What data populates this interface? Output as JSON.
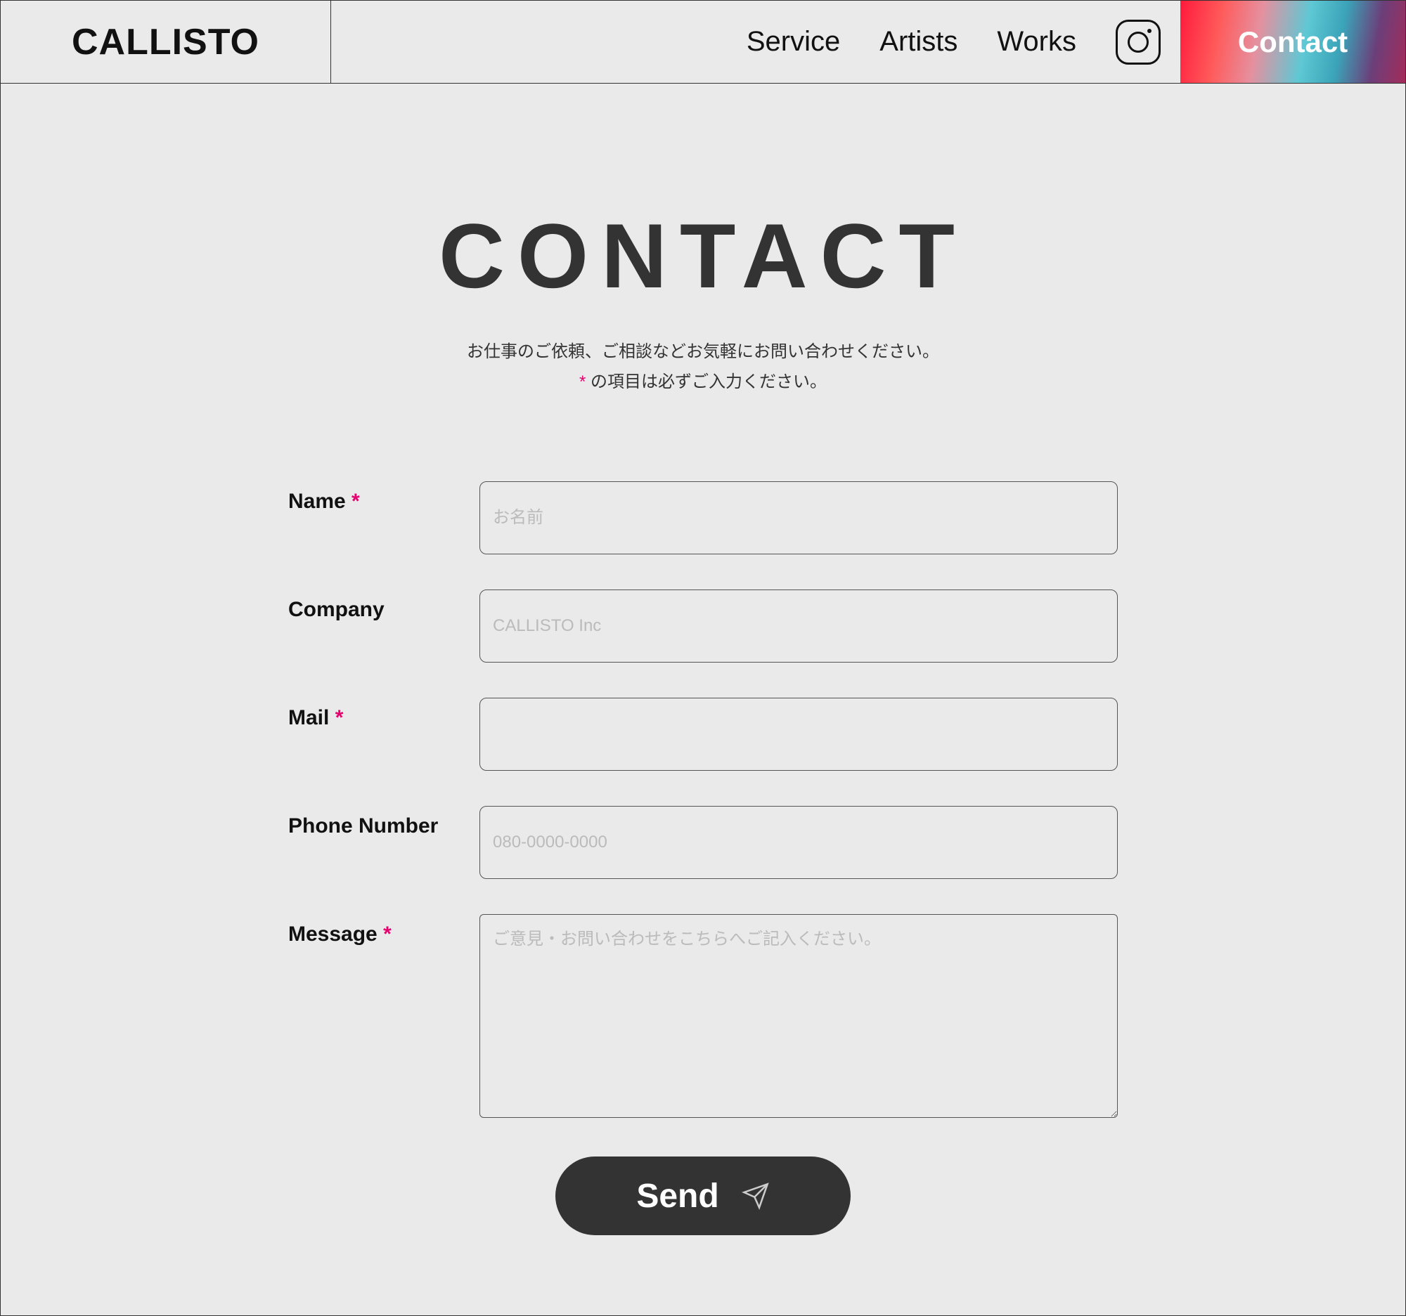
{
  "header": {
    "logo": "CALLISTO",
    "nav": {
      "service": "Service",
      "artists": "Artists",
      "works": "Works",
      "contact": "Contact"
    }
  },
  "main": {
    "title": "CONTACT",
    "subtitle_line1": "お仕事のご依頼、ご相談などお気軽にお問い合わせください。",
    "subtitle_asterisk": "*",
    "subtitle_line2_after": " の項目は必ずご入力ください。"
  },
  "form": {
    "name": {
      "label": "Name ",
      "required": "*",
      "placeholder": "お名前"
    },
    "company": {
      "label": "Company",
      "placeholder": "CALLISTO Inc"
    },
    "mail": {
      "label": "Mail ",
      "required": "*",
      "placeholder": ""
    },
    "phone": {
      "label": "Phone Number",
      "placeholder": "080-0000-0000"
    },
    "message": {
      "label": "Message ",
      "required": "*",
      "placeholder": "ご意見・お問い合わせをこちらへご記入ください。"
    },
    "send_label": "Send"
  }
}
